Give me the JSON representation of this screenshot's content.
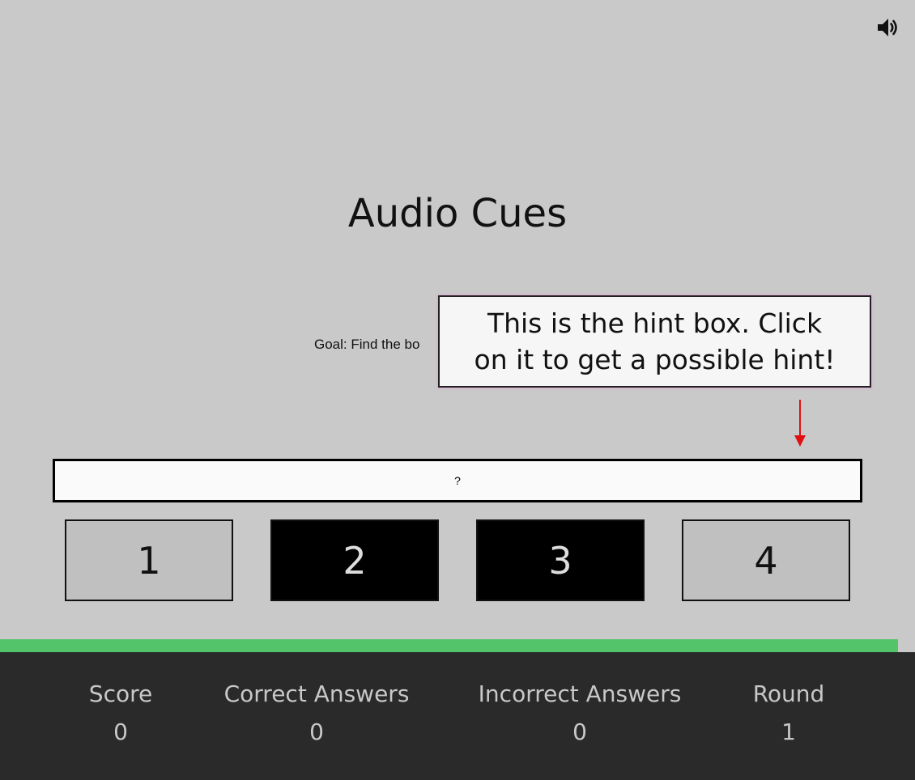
{
  "header": {
    "sound_icon": "speaker-volume-icon"
  },
  "game": {
    "title": "Audio Cues",
    "goal_text": "Goal: Find the bo",
    "hint_tooltip": "This is the hint box. Click on it to get a possible hint!",
    "hint_box_text": "?",
    "choices": [
      {
        "label": "1",
        "style": "light"
      },
      {
        "label": "2",
        "style": "dark"
      },
      {
        "label": "3",
        "style": "dark"
      },
      {
        "label": "4",
        "style": "light"
      }
    ],
    "timer_fraction": 0.981,
    "colors": {
      "background": "#c9c9c9",
      "timer": "#54c46b",
      "footer": "#2a2a2a",
      "arrow": "#e01010",
      "tooltip_glow": "#e3a6d6"
    }
  },
  "stats": {
    "score_label": "Score",
    "score_value": "0",
    "correct_label": "Correct Answers",
    "correct_value": "0",
    "incorrect_label": "Incorrect Answers",
    "incorrect_value": "0",
    "round_label": "Round",
    "round_value": "1"
  }
}
